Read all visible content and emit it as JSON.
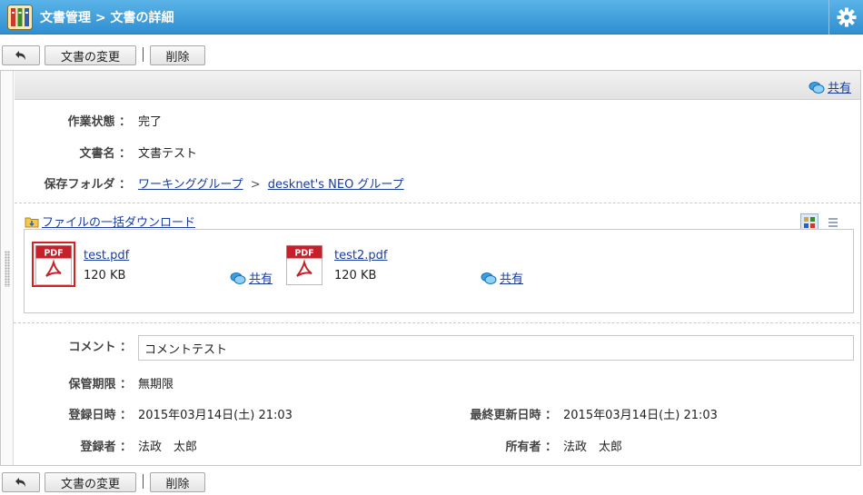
{
  "header": {
    "title": "文書管理 > 文書の詳細"
  },
  "toolbar": {
    "change_label": "文書の変更",
    "delete_label": "削除"
  },
  "panel": {
    "share_label": "共有"
  },
  "fields": {
    "status_label": "作業状態 ：",
    "status_value": "完了",
    "name_label": "文書名 ：",
    "name_value": "文書テスト",
    "folder_label": "保存フォルダ ：",
    "folder_path": [
      "ワーキンググループ",
      "desknet's NEO グループ"
    ],
    "folder_sep": ">"
  },
  "files": {
    "bulk_download": "ファイルの一括ダウンロード",
    "items": [
      {
        "icon_text": "PDF",
        "name": "test.pdf",
        "size": "120 KB",
        "share": "共有"
      },
      {
        "icon_text": "PDF",
        "name": "test2.pdf",
        "size": "120 KB",
        "share": "共有"
      }
    ]
  },
  "details": {
    "comment_label": "コメント ：",
    "comment_value": "コメントテスト",
    "retention_label": "保管期限 ：",
    "retention_value": "無期限",
    "registered_at_label": "登録日時 ：",
    "registered_at_value": "2015年03月14日(土) 21:03",
    "updated_at_label": "最終更新日時 ：",
    "updated_at_value": "2015年03月14日(土) 21:03",
    "registrant_label": "登録者 ：",
    "registrant_value": "法政　太郎",
    "owner_label": "所有者 ：",
    "owner_value": "法政　太郎"
  },
  "colors": {
    "header": "#2f8fd0",
    "link": "#1a3d9c",
    "pdf_red": "#c8202a"
  }
}
